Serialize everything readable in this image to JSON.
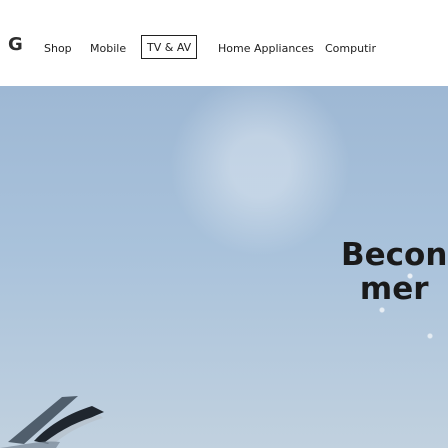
{
  "brand": {
    "logo": "G"
  },
  "nav": {
    "items": [
      {
        "label": "Shop"
      },
      {
        "label": "Mobile"
      },
      {
        "label": "TV & AV",
        "active": true
      },
      {
        "label": "Home Appliances"
      },
      {
        "label": "Computir"
      }
    ]
  },
  "hero": {
    "headline": "Becon\nmer"
  },
  "colors": {
    "sky": "#a9c2db",
    "text": "#1a1a1a",
    "accent": "#202020"
  }
}
